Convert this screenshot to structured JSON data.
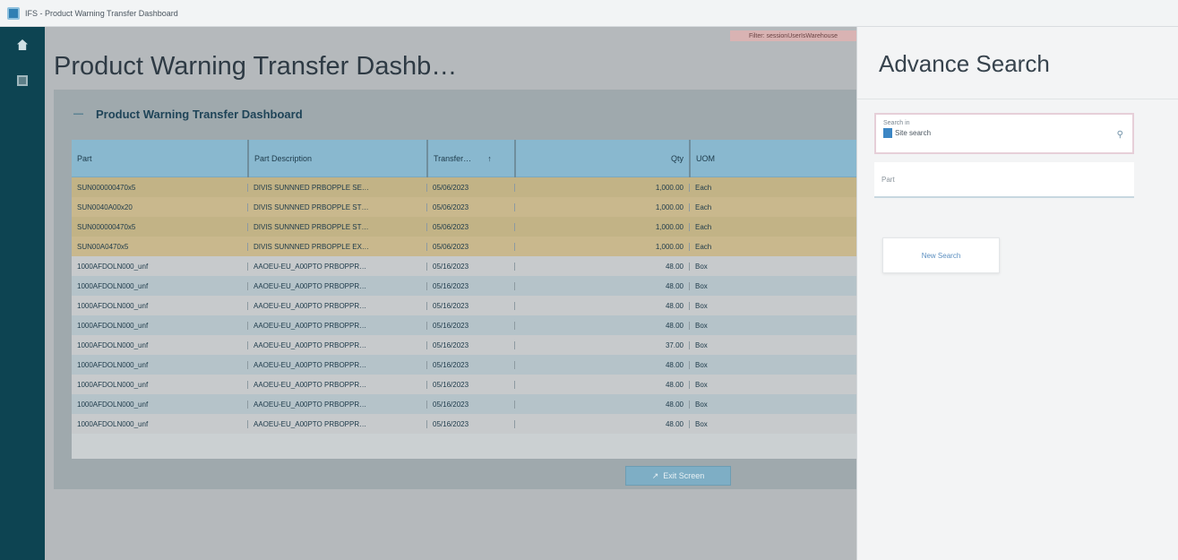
{
  "window": {
    "title": "IFS - Product Warning Transfer Dashboard"
  },
  "rail": {
    "items": [
      {
        "icon": "home-icon"
      },
      {
        "icon": "list-icon"
      }
    ]
  },
  "main": {
    "user_badge": "Filter: sessionUserIsWarehouse",
    "page_title": "Product Warning Transfer Dashb…",
    "section_title": "Product Warning Transfer Dashboard",
    "columns": [
      "Part",
      "Part Description",
      "Transfer…",
      "Qty",
      "UOM"
    ],
    "rows": [
      {
        "part": "SUN000000470x5",
        "desc": "DIVIS SUNNNED PRBOPPLE SE…",
        "date": "05/06/2023",
        "qty": "1,000.00",
        "uom": "Each",
        "highlight": true
      },
      {
        "part": "SUN0040A00x20",
        "desc": "DIVIS SUNNNED PRBOPPLE ST…",
        "date": "05/06/2023",
        "qty": "1,000.00",
        "uom": "Each",
        "highlight": true
      },
      {
        "part": "SUN000000470x5",
        "desc": "DIVIS SUNNNED PRBOPPLE ST…",
        "date": "05/06/2023",
        "qty": "1,000.00",
        "uom": "Each",
        "highlight": true
      },
      {
        "part": "SUN00A0470x5",
        "desc": "DIVIS SUNNNED PRBOPPLE EX…",
        "date": "05/06/2023",
        "qty": "1,000.00",
        "uom": "Each",
        "highlight": true
      },
      {
        "part": "1000AFDOLN000_unf",
        "desc": "AAOEU-EU_A00PTO PRBOPPR…",
        "date": "05/16/2023",
        "qty": "48.00",
        "uom": "Box",
        "highlight": false
      },
      {
        "part": "1000AFDOLN000_unf",
        "desc": "AAOEU-EU_A00PTO PRBOPPR…",
        "date": "05/16/2023",
        "qty": "48.00",
        "uom": "Box",
        "highlight": false
      },
      {
        "part": "1000AFDOLN000_unf",
        "desc": "AAOEU-EU_A00PTO PRBOPPR…",
        "date": "05/16/2023",
        "qty": "48.00",
        "uom": "Box",
        "highlight": false
      },
      {
        "part": "1000AFDOLN000_unf",
        "desc": "AAOEU-EU_A00PTO PRBOPPR…",
        "date": "05/16/2023",
        "qty": "48.00",
        "uom": "Box",
        "highlight": false
      },
      {
        "part": "1000AFDOLN000_unf",
        "desc": "AAOEU-EU_A00PTO PRBOPPR…",
        "date": "05/16/2023",
        "qty": "37.00",
        "uom": "Box",
        "highlight": false
      },
      {
        "part": "1000AFDOLN000_unf",
        "desc": "AAOEU-EU_A00PTO PRBOPPR…",
        "date": "05/16/2023",
        "qty": "48.00",
        "uom": "Box",
        "highlight": false
      },
      {
        "part": "1000AFDOLN000_unf",
        "desc": "AAOEU-EU_A00PTO PRBOPPR…",
        "date": "05/16/2023",
        "qty": "48.00",
        "uom": "Box",
        "highlight": false
      },
      {
        "part": "1000AFDOLN000_unf",
        "desc": "AAOEU-EU_A00PTO PRBOPPR…",
        "date": "05/16/2023",
        "qty": "48.00",
        "uom": "Box",
        "highlight": false
      },
      {
        "part": "1000AFDOLN000_unf",
        "desc": "AAOEU-EU_A00PTO PRBOPPR…",
        "date": "05/16/2023",
        "qty": "48.00",
        "uom": "Box",
        "highlight": false
      }
    ],
    "exit_button": "Exit Screen"
  },
  "panel": {
    "title": "Advance Search",
    "search": {
      "label": "Search in",
      "value": "Site search"
    },
    "part_placeholder": "Part",
    "new_search_button": "New Search"
  },
  "colors": {
    "rail": "#0d4452",
    "grid_header": "#89b8cf",
    "highlight_row": "#c9b88d",
    "accent": "#3c86c4"
  }
}
